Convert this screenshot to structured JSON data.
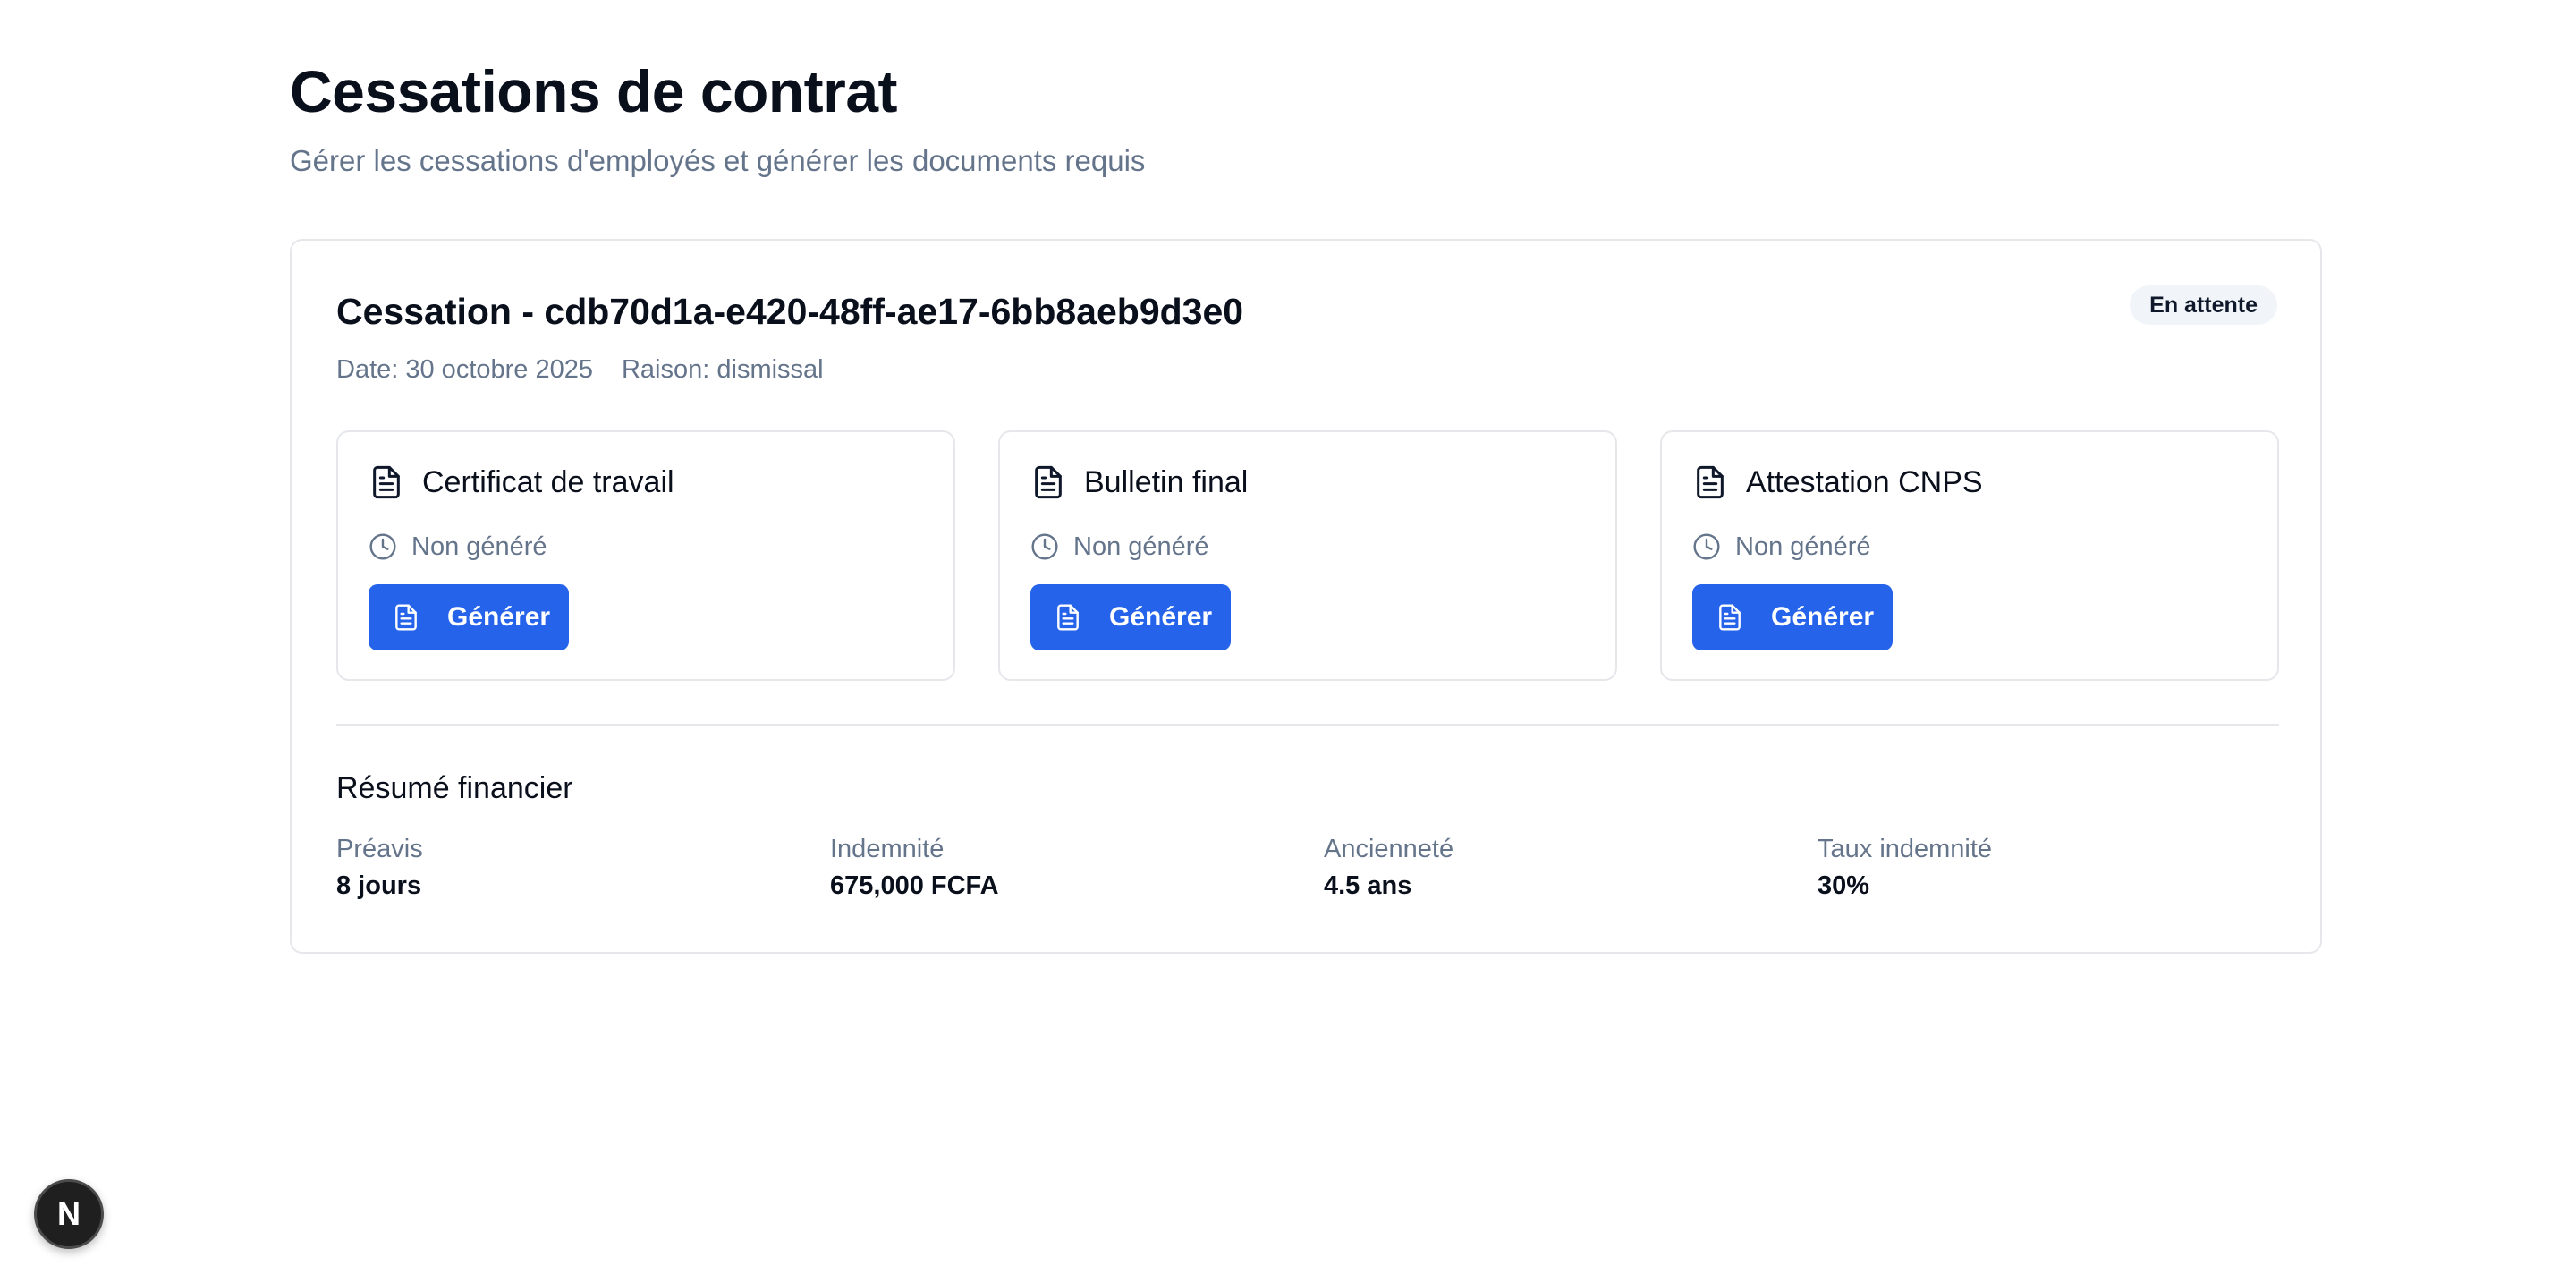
{
  "header": {
    "title": "Cessations de contrat",
    "subtitle": "Gérer les cessations d'employés et générer les documents requis"
  },
  "cessation": {
    "title": "Cessation - cdb70d1a-e420-48ff-ae17-6bb8aeb9d3e0",
    "date_text": "Date: 30 octobre 2025",
    "reason_text": "Raison: dismissal",
    "status_badge": "En attente",
    "documents": [
      {
        "title": "Certificat de travail",
        "status": "Non généré",
        "button_label": "Générer",
        "icon": "file-text-icon"
      },
      {
        "title": "Bulletin final",
        "status": "Non généré",
        "button_label": "Générer",
        "icon": "file-text-icon"
      },
      {
        "title": "Attestation CNPS",
        "status": "Non généré",
        "button_label": "Générer",
        "icon": "file-text-icon"
      }
    ],
    "financial_summary": {
      "title": "Résumé financier",
      "items": [
        {
          "label": "Préavis",
          "value": "8 jours"
        },
        {
          "label": "Indemnité",
          "value": "675,000 FCFA"
        },
        {
          "label": "Ancienneté",
          "value": "4.5 ans"
        },
        {
          "label": "Taux indemnité",
          "value": "30%"
        }
      ]
    }
  },
  "dev_badge": {
    "letter": "N"
  },
  "colors": {
    "primary_button": "#2563eb",
    "muted_text": "#64748b",
    "border": "#e5e7eb",
    "badge_bg": "#f1f5f9"
  }
}
